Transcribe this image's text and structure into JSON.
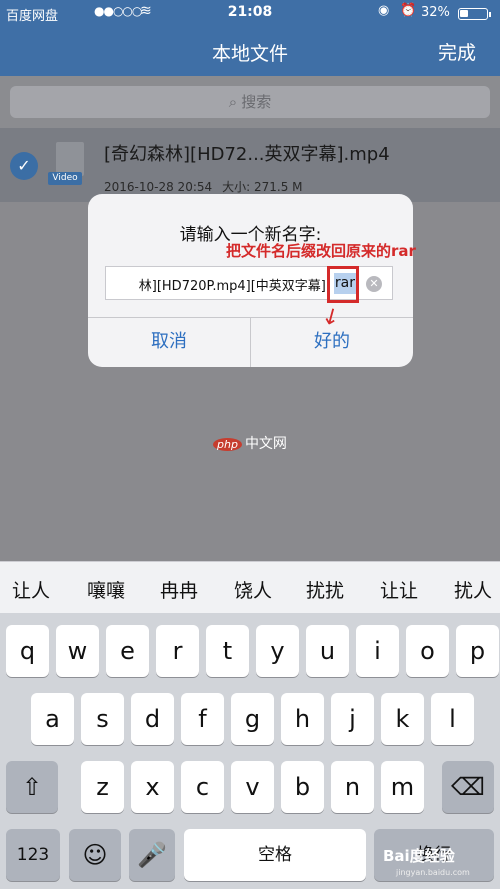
{
  "status": {
    "carrier": "百度网盘",
    "signal": "●●○○○",
    "wifi": "≋",
    "time": "21:08",
    "lock": "◉",
    "alarm": "⏰",
    "battery_pct": "32%",
    "battery_level": 0.32
  },
  "nav": {
    "title": "本地文件",
    "done": "完成"
  },
  "search": {
    "placeholder": "搜索",
    "icon": "search-icon"
  },
  "file": {
    "name": "[奇幻森林][HD72...英双字幕].mp4",
    "badge": "Video",
    "date": "2016-10-28 20:54",
    "size": "大小: 271.5 M",
    "checked": true
  },
  "dialog": {
    "title": "请输入一个新名字:",
    "input_text": "林][HD720P.mp4][中英双字幕].",
    "input_selected": "rar",
    "cancel": "取消",
    "ok": "好的"
  },
  "annotation": {
    "text": "把文件名后缀改回原来的rar",
    "color": "#d42a2a"
  },
  "watermark": {
    "logo": "php",
    "text": "中文网"
  },
  "keyboard": {
    "candidates": [
      "让人",
      "嚷嚷",
      "冉冉",
      "饶人",
      "扰扰",
      "让让",
      "扰人"
    ],
    "row1": [
      "q",
      "w",
      "e",
      "r",
      "t",
      "y",
      "u",
      "i",
      "o",
      "p"
    ],
    "row2": [
      "a",
      "s",
      "d",
      "f",
      "g",
      "h",
      "j",
      "k",
      "l"
    ],
    "row3": [
      "z",
      "x",
      "c",
      "v",
      "b",
      "n",
      "m"
    ],
    "shift": "⇧",
    "delete": "⌫",
    "numbers": "123",
    "emoji": "☺",
    "mic": "🎤",
    "space": "空格",
    "return": "换行"
  },
  "baidu_watermark": {
    "text": "Bai度经验",
    "url": "jingyan.baidu.com"
  },
  "colors": {
    "nav_blue": "#3f6fa6",
    "link_blue": "#2d6fc0",
    "annotation_red": "#d42a2a"
  }
}
